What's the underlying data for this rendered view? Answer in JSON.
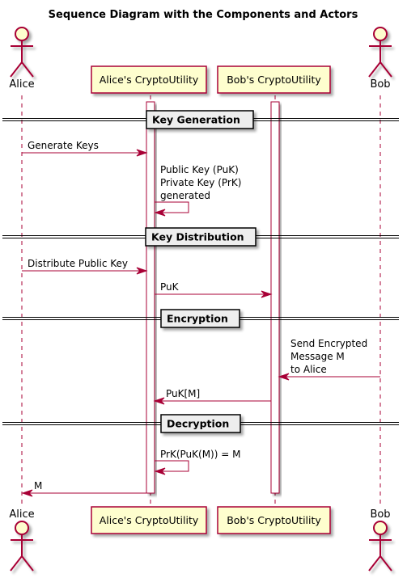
{
  "title": "Sequence Diagram with the Components and Actors",
  "colors": {
    "line": "#A80036",
    "participant_fill": "#FEFECE",
    "divider_fill": "#EEEEEE",
    "shadow": "#C9C9C9"
  },
  "participants": [
    {
      "id": "alice",
      "label": "Alice",
      "kind": "actor"
    },
    {
      "id": "alice_cu",
      "label": "Alice's CryptoUtility",
      "kind": "participant"
    },
    {
      "id": "bob_cu",
      "label": "Bob's CryptoUtility",
      "kind": "participant"
    },
    {
      "id": "bob",
      "label": "Bob",
      "kind": "actor"
    }
  ],
  "dividers": [
    {
      "label": "Key Generation"
    },
    {
      "label": "Key Distribution"
    },
    {
      "label": "Encryption"
    },
    {
      "label": "Decryption"
    }
  ],
  "messages": [
    {
      "from": "alice",
      "to": "alice_cu",
      "lines": [
        "Generate Keys"
      ]
    },
    {
      "from": "alice_cu",
      "to": "alice_cu",
      "lines": [
        "Public Key (PuK)",
        "Private Key (PrK)",
        "generated"
      ]
    },
    {
      "from": "alice",
      "to": "alice_cu",
      "lines": [
        "Distribute Public Key"
      ]
    },
    {
      "from": "alice_cu",
      "to": "bob_cu",
      "lines": [
        "PuK"
      ]
    },
    {
      "from": "bob",
      "to": "bob_cu",
      "lines": [
        "Send Encrypted",
        "Message M",
        "to Alice"
      ]
    },
    {
      "from": "bob_cu",
      "to": "alice_cu",
      "lines": [
        "PuK[M]"
      ]
    },
    {
      "from": "alice_cu",
      "to": "alice_cu",
      "lines": [
        "PrK(PuK(M)) = M"
      ]
    },
    {
      "from": "alice_cu",
      "to": "alice",
      "lines": [
        "M"
      ]
    }
  ]
}
